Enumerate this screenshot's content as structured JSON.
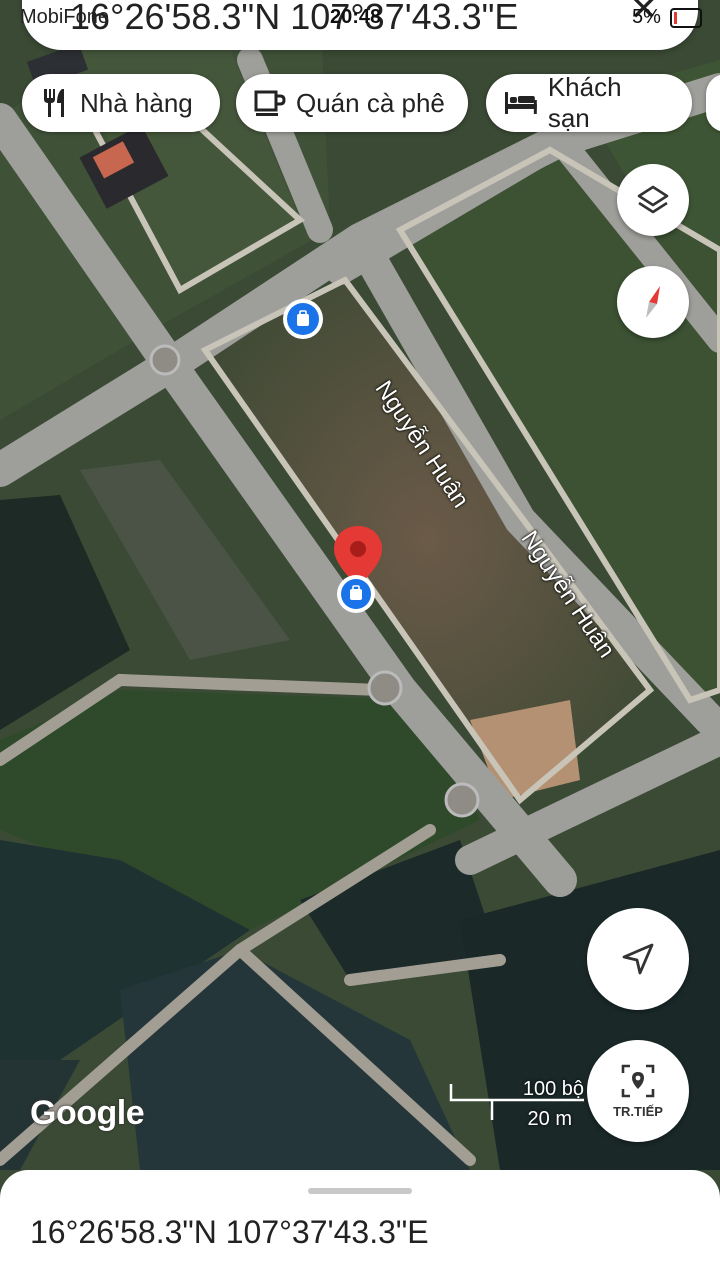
{
  "status_bar": {
    "carrier": "MobiFone",
    "time": "20:48",
    "battery": "5%"
  },
  "top_card": {
    "coordinates": "16°26'58.3\"N 107°37'43.3\"E"
  },
  "chips": [
    {
      "label": "Nhà hàng",
      "icon": "fork-knife-icon"
    },
    {
      "label": "Quán cà phê",
      "icon": "coffee-cup-icon"
    },
    {
      "label": "Khách sạn",
      "icon": "bed-icon"
    }
  ],
  "map": {
    "streets": [
      {
        "name": "Nguyễn Huân"
      },
      {
        "name": "Nguyễn Huân"
      }
    ],
    "scale": {
      "imperial": "100 bộ",
      "metric": "20 m"
    },
    "attribution": "Google"
  },
  "controls": {
    "layers": "layers-icon",
    "compass": "compass-icon",
    "my_location": "navigation-arrow-icon",
    "live_view": {
      "label": "TR.TIẾP",
      "icon": "live-view-icon"
    }
  },
  "bottom_sheet": {
    "coordinates": "16°26'58.3\"N 107°37'43.3\"E"
  },
  "colors": {
    "pin_red": "#e53935",
    "poi_blue": "#1a73e8"
  }
}
